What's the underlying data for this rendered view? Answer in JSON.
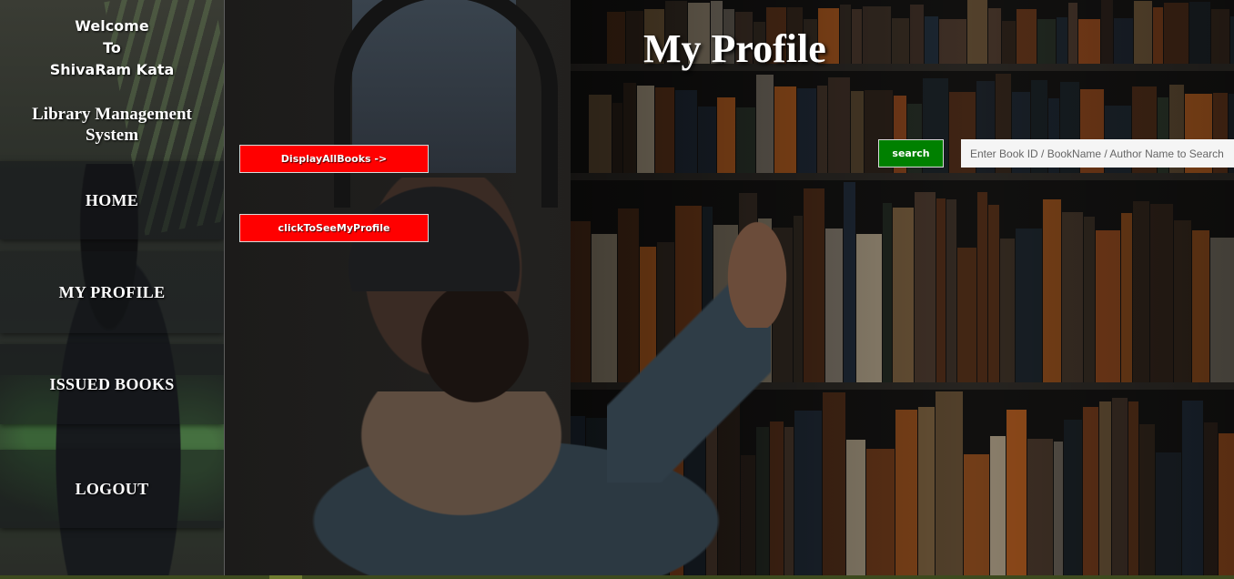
{
  "sidebar": {
    "welcome_line1": "Welcome",
    "welcome_line2": "To",
    "welcome_line3": "ShivaRam Kata",
    "system_line1": "Library Management",
    "system_line2": "System",
    "nav": {
      "home": "HOME",
      "my_profile": "MY PROFILE",
      "issued_books": "ISSUED BOOKS",
      "logout": "LOGOUT"
    }
  },
  "main": {
    "title": "My Profile",
    "display_all_books_label": "DisplayAllBooks ->",
    "see_my_profile_label": "clickToSeeMyProfile",
    "search_button_label": "search",
    "search_placeholder": "Enter Book ID / BookName / Author Name to Search",
    "search_value": ""
  },
  "colors": {
    "action_button": "#ff0000",
    "search_button": "#008000",
    "bottom_bar": "#3d4a1e"
  },
  "icons": [
    "background-photo"
  ]
}
